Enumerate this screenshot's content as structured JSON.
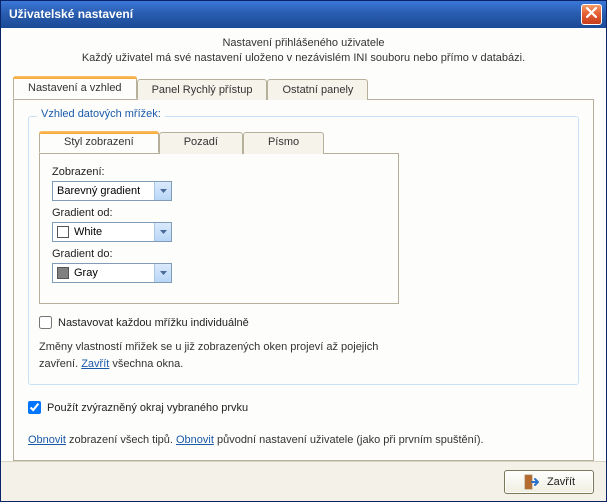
{
  "window": {
    "title": "Uživatelské nastavení"
  },
  "intro": {
    "line1": "Nastavení přihlášeného uživatele",
    "line2": "Každý uživatel má své nastavení uloženo v nezávislém INI souboru nebo přímo v databázi."
  },
  "tabs": {
    "appearance": "Nastavení a vzhled",
    "quick": "Panel Rychlý přístup",
    "other": "Ostatní panely"
  },
  "group": {
    "title": "Vzhled datových mřížek:"
  },
  "subtabs": {
    "style": "Styl zobrazení",
    "background": "Pozadí",
    "font": "Písmo"
  },
  "fields": {
    "display_label": "Zobrazení:",
    "display_value": "Barevný gradient",
    "grad_from_label": "Gradient od:",
    "grad_from_value": "White",
    "grad_to_label": "Gradient do:",
    "grad_to_value": "Gray"
  },
  "colors": {
    "white": "#ffffff",
    "gray": "#808080"
  },
  "checks": {
    "individual": "Nastavovat každou mřížku individuálně",
    "highlight": "Použít zvýrazněný okraj vybraného prvku"
  },
  "note": {
    "part1": "Změny vlastností mřižek se u již zobrazených oken projeví až pojejich zavření. ",
    "close_link": "Zavřít",
    "part2": " všechna okna."
  },
  "restore": {
    "link1": "Obnovit",
    "text1": " zobrazení všech tipů. ",
    "link2": "Obnovit",
    "text2": " původní nastavení uživatele (jako při prvním spuštění)."
  },
  "footer": {
    "close": "Zavřít"
  }
}
